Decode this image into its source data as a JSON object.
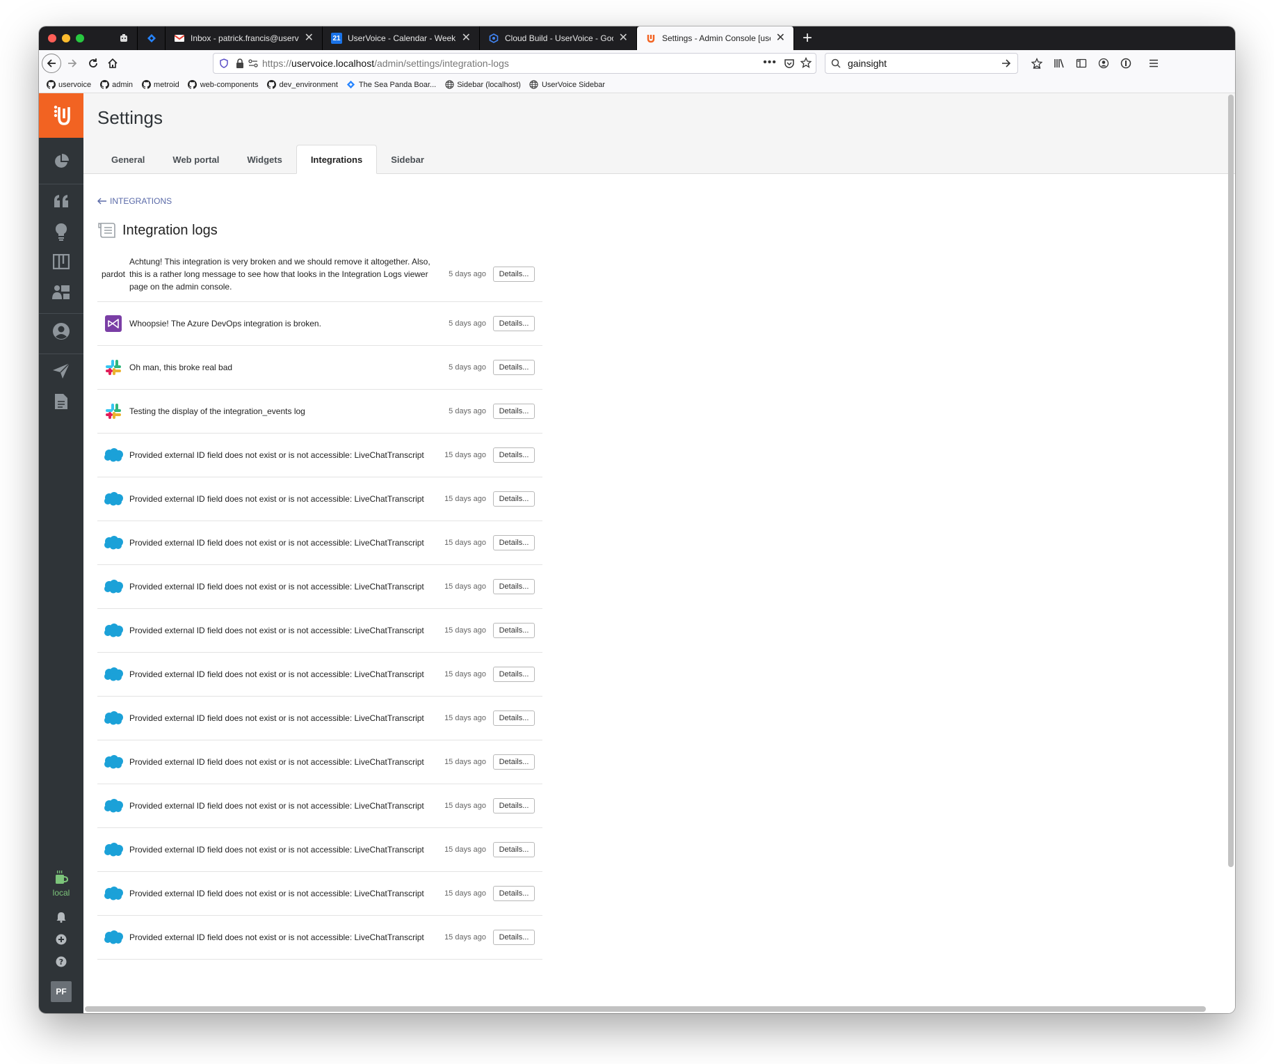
{
  "browser": {
    "tabs": [
      {
        "title": "",
        "icon": "extension-icon",
        "active": false
      },
      {
        "title": "",
        "icon": "jira-icon",
        "active": false
      },
      {
        "title": "Inbox - patrick.francis@uservoi",
        "icon": "gmail-icon",
        "active": false
      },
      {
        "title": "UserVoice - Calendar - Week of",
        "icon": "calendar-icon",
        "active": false
      },
      {
        "title": "Cloud Build - UserVoice - Goog",
        "icon": "cloud-build-icon",
        "active": false
      },
      {
        "title": "Settings - Admin Console [user",
        "icon": "uservoice-icon",
        "active": true
      }
    ],
    "url_prefix": "https://",
    "url_host": "uservoice.localhost",
    "url_path": "/admin/settings/integration-logs",
    "search_value": "gainsight",
    "bookmarks": [
      {
        "label": "uservoice",
        "icon": "github-icon"
      },
      {
        "label": "admin",
        "icon": "github-icon"
      },
      {
        "label": "metroid",
        "icon": "github-icon"
      },
      {
        "label": "web-components",
        "icon": "github-icon"
      },
      {
        "label": "dev_environment",
        "icon": "github-icon"
      },
      {
        "label": "The Sea Panda Boar...",
        "icon": "jira-icon"
      },
      {
        "label": "Sidebar (localhost)",
        "icon": "globe-icon"
      },
      {
        "label": "UserVoice Sidebar",
        "icon": "globe-icon"
      }
    ]
  },
  "sidebar": {
    "env_label": "local",
    "avatar_initials": "PF"
  },
  "settings": {
    "title": "Settings",
    "tabs": [
      {
        "label": "General",
        "active": false
      },
      {
        "label": "Web portal",
        "active": false
      },
      {
        "label": "Widgets",
        "active": false
      },
      {
        "label": "Integrations",
        "active": true
      },
      {
        "label": "Sidebar",
        "active": false
      }
    ],
    "back_link": "INTEGRATIONS",
    "heading": "Integration logs",
    "details_label": "Details...",
    "logs": [
      {
        "source": "pardot",
        "icon": "pardot-text",
        "message": "Achtung! This integration is very broken and we should remove it altogether. Also, this is a rather long message to see how that looks in the Integration Logs viewer page on the admin console.",
        "time": "5 days ago"
      },
      {
        "source": "azure-devops",
        "icon": "azure-devops-icon",
        "message": "Whoopsie! The Azure DevOps integration is broken.",
        "time": "5 days ago"
      },
      {
        "source": "slack",
        "icon": "slack-icon",
        "message": "Oh man, this broke real bad",
        "time": "5 days ago"
      },
      {
        "source": "slack",
        "icon": "slack-icon",
        "message": "Testing the display of the integration_events log",
        "time": "5 days ago"
      },
      {
        "source": "salesforce",
        "icon": "salesforce-icon",
        "message": "Provided external ID field does not exist or is not accessible: LiveChatTranscript",
        "time": "15 days ago"
      },
      {
        "source": "salesforce",
        "icon": "salesforce-icon",
        "message": "Provided external ID field does not exist or is not accessible: LiveChatTranscript",
        "time": "15 days ago"
      },
      {
        "source": "salesforce",
        "icon": "salesforce-icon",
        "message": "Provided external ID field does not exist or is not accessible: LiveChatTranscript",
        "time": "15 days ago"
      },
      {
        "source": "salesforce",
        "icon": "salesforce-icon",
        "message": "Provided external ID field does not exist or is not accessible: LiveChatTranscript",
        "time": "15 days ago"
      },
      {
        "source": "salesforce",
        "icon": "salesforce-icon",
        "message": "Provided external ID field does not exist or is not accessible: LiveChatTranscript",
        "time": "15 days ago"
      },
      {
        "source": "salesforce",
        "icon": "salesforce-icon",
        "message": "Provided external ID field does not exist or is not accessible: LiveChatTranscript",
        "time": "15 days ago"
      },
      {
        "source": "salesforce",
        "icon": "salesforce-icon",
        "message": "Provided external ID field does not exist or is not accessible: LiveChatTranscript",
        "time": "15 days ago"
      },
      {
        "source": "salesforce",
        "icon": "salesforce-icon",
        "message": "Provided external ID field does not exist or is not accessible: LiveChatTranscript",
        "time": "15 days ago"
      },
      {
        "source": "salesforce",
        "icon": "salesforce-icon",
        "message": "Provided external ID field does not exist or is not accessible: LiveChatTranscript",
        "time": "15 days ago"
      },
      {
        "source": "salesforce",
        "icon": "salesforce-icon",
        "message": "Provided external ID field does not exist or is not accessible: LiveChatTranscript",
        "time": "15 days ago"
      },
      {
        "source": "salesforce",
        "icon": "salesforce-icon",
        "message": "Provided external ID field does not exist or is not accessible: LiveChatTranscript",
        "time": "15 days ago"
      },
      {
        "source": "salesforce",
        "icon": "salesforce-icon",
        "message": "Provided external ID field does not exist or is not accessible: LiveChatTranscript",
        "time": "15 days ago"
      }
    ]
  },
  "colors": {
    "brand_orange": "#f26322",
    "sidebar_bg": "#2f3438",
    "salesforce_blue": "#1ba1d8",
    "azure_purple": "#7a3ea5",
    "local_green": "#7cc47a"
  }
}
